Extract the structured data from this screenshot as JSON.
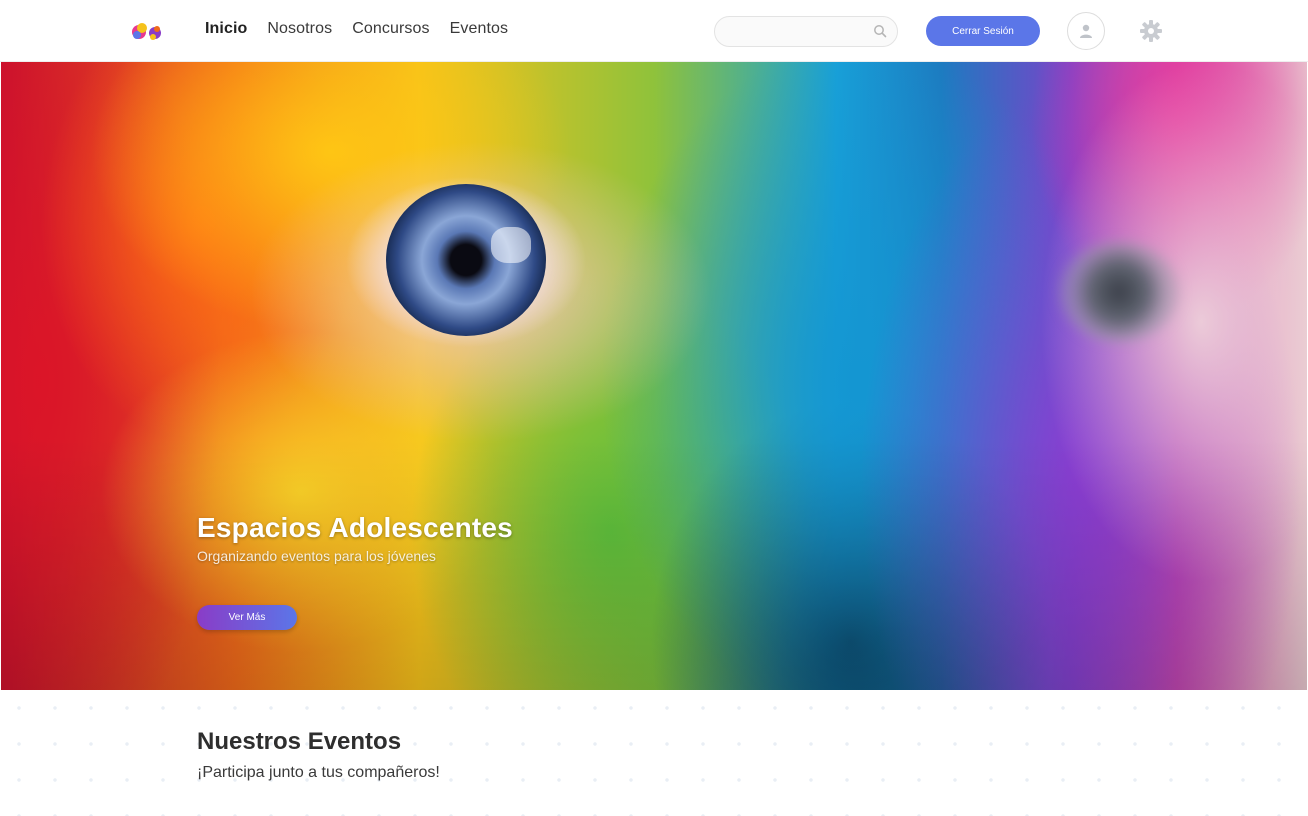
{
  "nav": {
    "links": [
      "Inicio",
      "Nosotros",
      "Concursos",
      "Eventos"
    ],
    "active_index": 0,
    "search_placeholder": "",
    "logout_label": "Cerrar Sesión",
    "accent_color": "#5b76e8"
  },
  "hero": {
    "title": "Espacios Adolescentes",
    "subtitle": "Organizando eventos para los jóvenes",
    "cta_label": "Ver Más"
  },
  "events": {
    "title": "Nuestros Eventos",
    "subtitle": "¡Participa junto a tus compañeros!"
  },
  "icons": [
    "logo-icon",
    "search-icon",
    "user-icon",
    "gear-icon"
  ]
}
